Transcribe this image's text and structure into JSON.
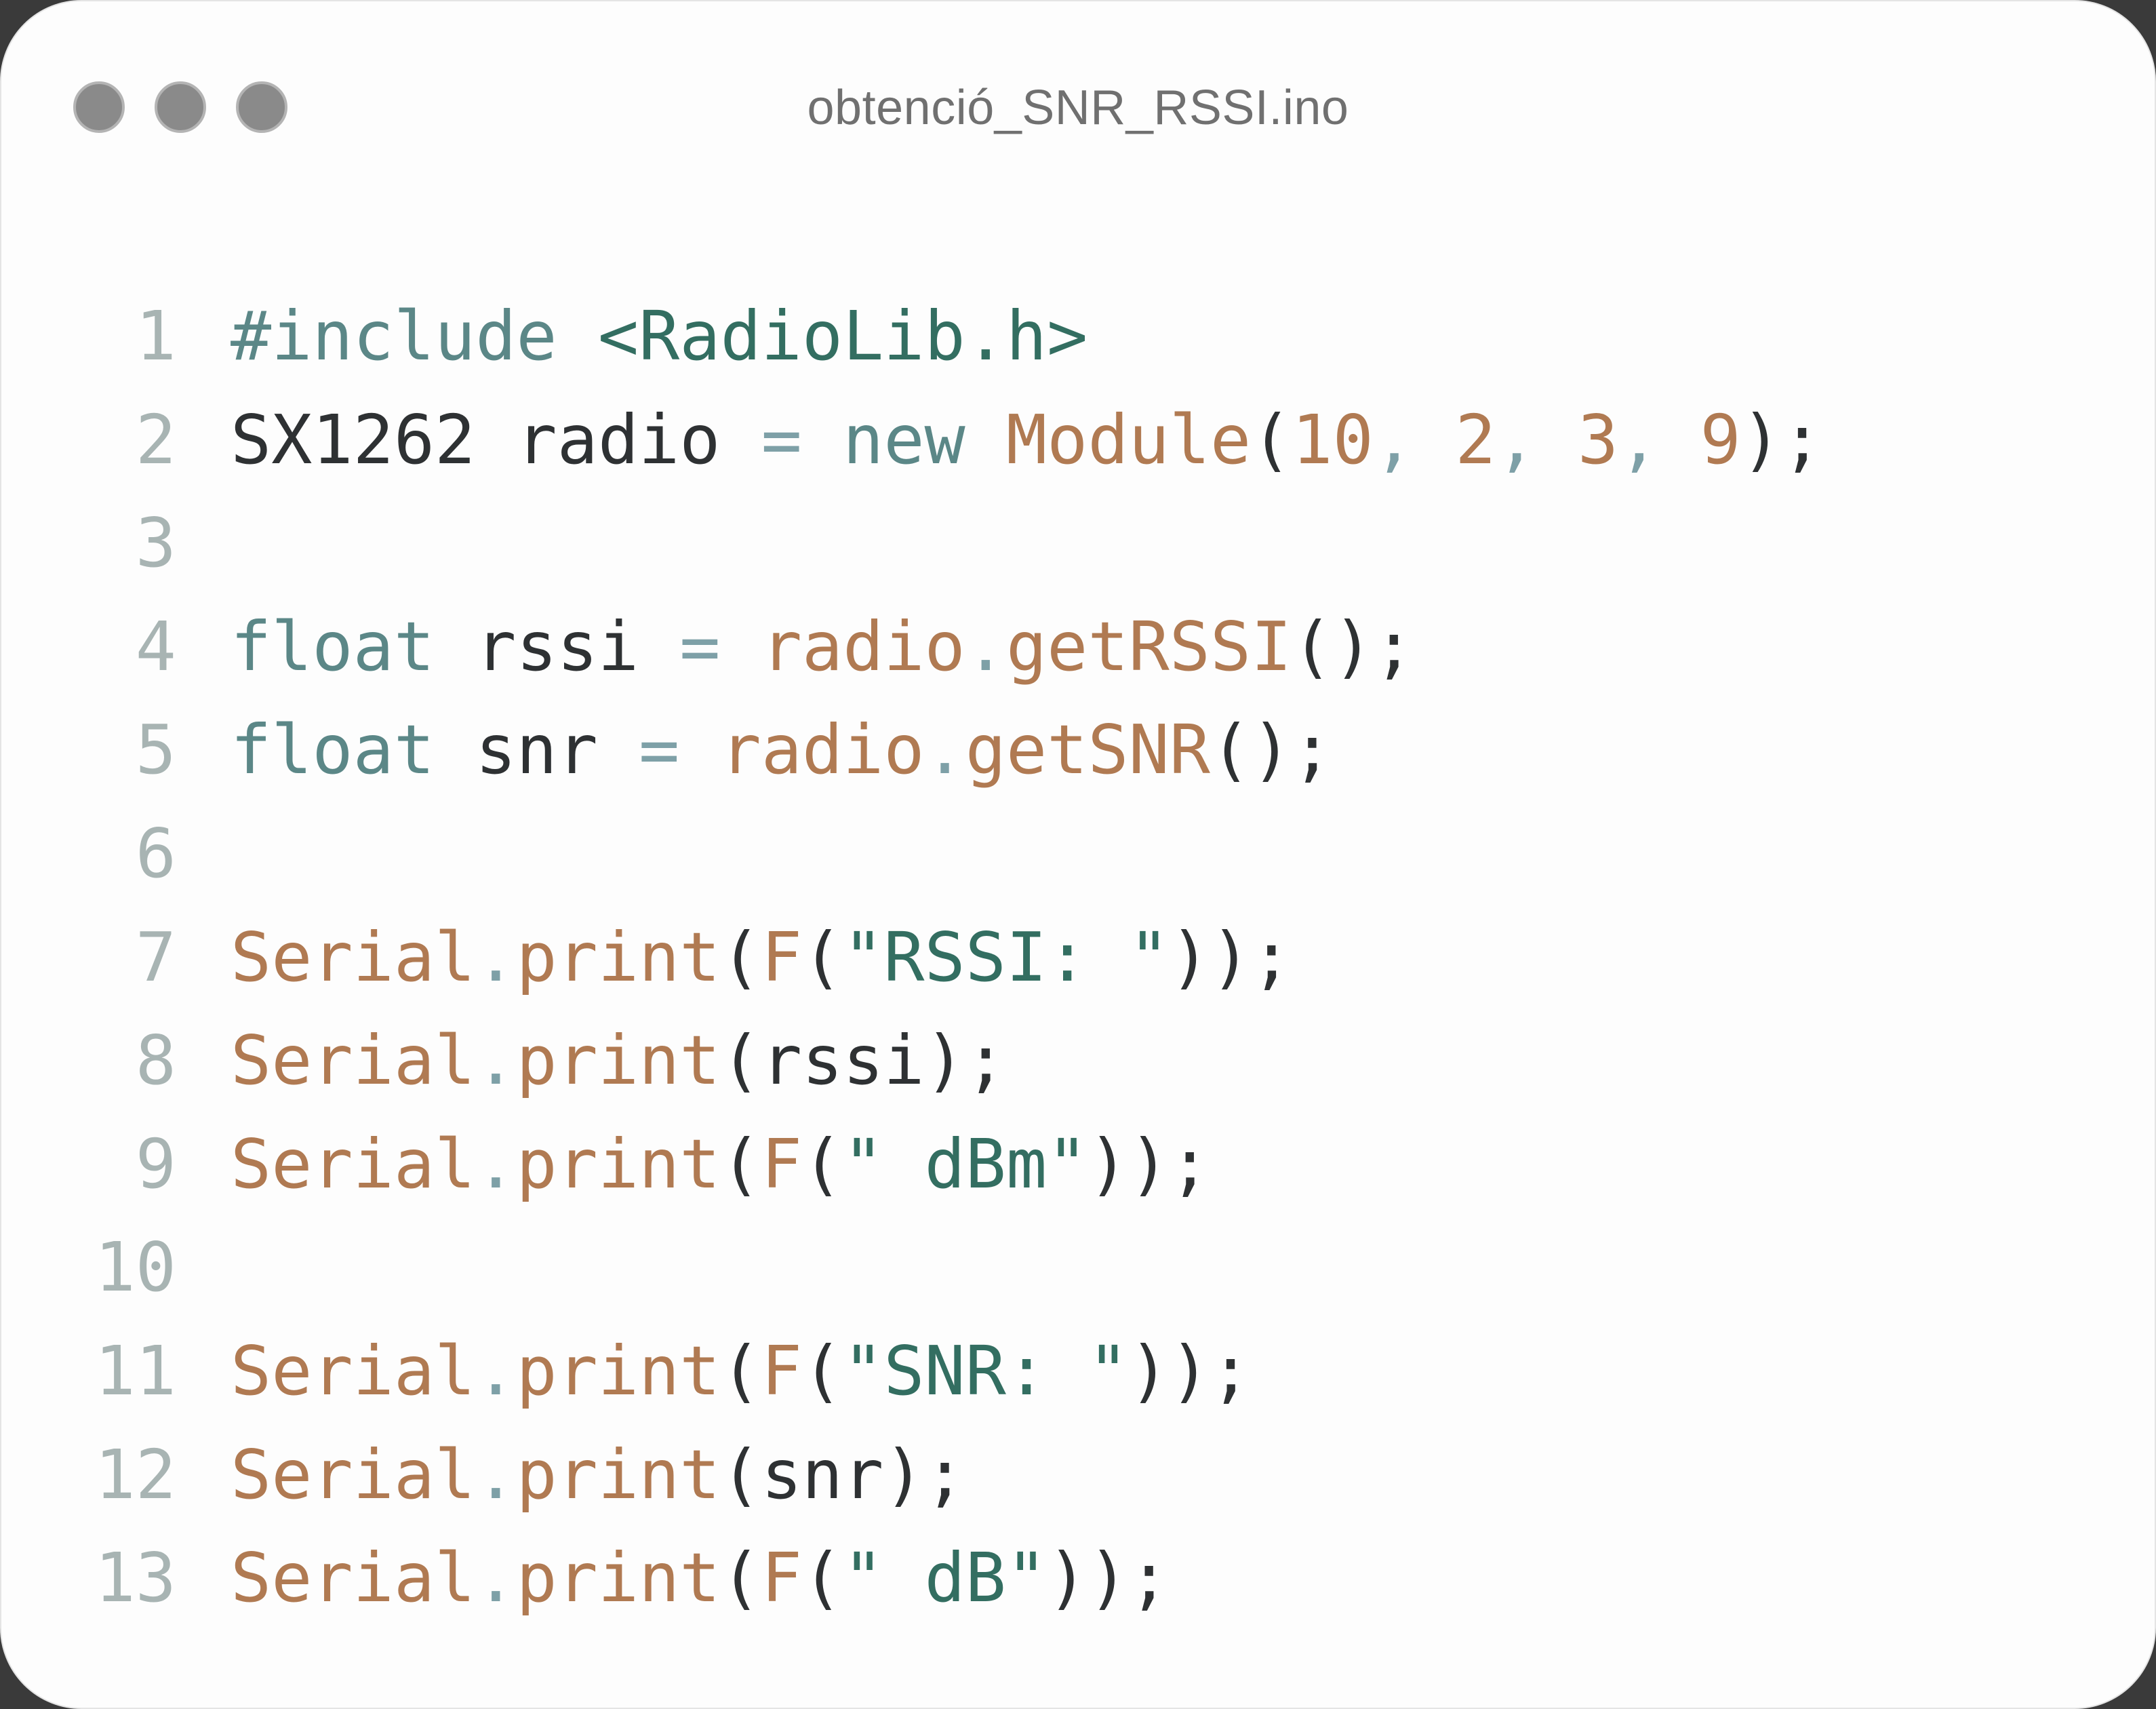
{
  "window": {
    "title": "obtenció_SNR_RSSI.ino"
  },
  "colors": {
    "keyword": "#5b8787",
    "string": "#336e61",
    "function": "#b07a52",
    "number": "#b07a52",
    "default": "#2e3133",
    "line_number": "#a8b4b3",
    "background": "#fdfdfd"
  },
  "editor": {
    "lines": [
      {
        "number": "1",
        "tokens": [
          {
            "t": "#include",
            "c": "kw"
          },
          {
            "t": " ",
            "c": "df"
          },
          {
            "t": "<RadioLib.h>",
            "c": "str"
          }
        ]
      },
      {
        "number": "2",
        "tokens": [
          {
            "t": "SX1262 radio ",
            "c": "df"
          },
          {
            "t": "=",
            "c": "pun"
          },
          {
            "t": " ",
            "c": "df"
          },
          {
            "t": "new",
            "c": "kw"
          },
          {
            "t": " ",
            "c": "df"
          },
          {
            "t": "Module",
            "c": "fn"
          },
          {
            "t": "(",
            "c": "df"
          },
          {
            "t": "10",
            "c": "num"
          },
          {
            "t": ", ",
            "c": "pun"
          },
          {
            "t": "2",
            "c": "num"
          },
          {
            "t": ", ",
            "c": "pun"
          },
          {
            "t": "3",
            "c": "num"
          },
          {
            "t": ", ",
            "c": "pun"
          },
          {
            "t": "9",
            "c": "num"
          },
          {
            "t": ");",
            "c": "df"
          }
        ]
      },
      {
        "number": "3",
        "tokens": []
      },
      {
        "number": "4",
        "tokens": [
          {
            "t": "float",
            "c": "kw"
          },
          {
            "t": " rssi ",
            "c": "df"
          },
          {
            "t": "=",
            "c": "pun"
          },
          {
            "t": " ",
            "c": "df"
          },
          {
            "t": "radio",
            "c": "fn"
          },
          {
            "t": ".",
            "c": "pun"
          },
          {
            "t": "getRSSI",
            "c": "fn"
          },
          {
            "t": "();",
            "c": "df"
          }
        ]
      },
      {
        "number": "5",
        "tokens": [
          {
            "t": "float",
            "c": "kw"
          },
          {
            "t": " snr ",
            "c": "df"
          },
          {
            "t": "=",
            "c": "pun"
          },
          {
            "t": " ",
            "c": "df"
          },
          {
            "t": "radio",
            "c": "fn"
          },
          {
            "t": ".",
            "c": "pun"
          },
          {
            "t": "getSNR",
            "c": "fn"
          },
          {
            "t": "();",
            "c": "df"
          }
        ]
      },
      {
        "number": "6",
        "tokens": []
      },
      {
        "number": "7",
        "tokens": [
          {
            "t": "Serial",
            "c": "fn"
          },
          {
            "t": ".",
            "c": "pun"
          },
          {
            "t": "print",
            "c": "fn"
          },
          {
            "t": "(",
            "c": "df"
          },
          {
            "t": "F",
            "c": "fn"
          },
          {
            "t": "(",
            "c": "df"
          },
          {
            "t": "\"RSSI: \"",
            "c": "str"
          },
          {
            "t": "));",
            "c": "df"
          }
        ]
      },
      {
        "number": "8",
        "tokens": [
          {
            "t": "Serial",
            "c": "fn"
          },
          {
            "t": ".",
            "c": "pun"
          },
          {
            "t": "print",
            "c": "fn"
          },
          {
            "t": "(rssi);",
            "c": "df"
          }
        ]
      },
      {
        "number": "9",
        "tokens": [
          {
            "t": "Serial",
            "c": "fn"
          },
          {
            "t": ".",
            "c": "pun"
          },
          {
            "t": "print",
            "c": "fn"
          },
          {
            "t": "(",
            "c": "df"
          },
          {
            "t": "F",
            "c": "fn"
          },
          {
            "t": "(",
            "c": "df"
          },
          {
            "t": "\" dBm\"",
            "c": "str"
          },
          {
            "t": "));",
            "c": "df"
          }
        ]
      },
      {
        "number": "10",
        "tokens": []
      },
      {
        "number": "11",
        "tokens": [
          {
            "t": "Serial",
            "c": "fn"
          },
          {
            "t": ".",
            "c": "pun"
          },
          {
            "t": "print",
            "c": "fn"
          },
          {
            "t": "(",
            "c": "df"
          },
          {
            "t": "F",
            "c": "fn"
          },
          {
            "t": "(",
            "c": "df"
          },
          {
            "t": "\"SNR: \"",
            "c": "str"
          },
          {
            "t": "));",
            "c": "df"
          }
        ]
      },
      {
        "number": "12",
        "tokens": [
          {
            "t": "Serial",
            "c": "fn"
          },
          {
            "t": ".",
            "c": "pun"
          },
          {
            "t": "print",
            "c": "fn"
          },
          {
            "t": "(snr);",
            "c": "df"
          }
        ]
      },
      {
        "number": "13",
        "tokens": [
          {
            "t": "Serial",
            "c": "fn"
          },
          {
            "t": ".",
            "c": "pun"
          },
          {
            "t": "print",
            "c": "fn"
          },
          {
            "t": "(",
            "c": "df"
          },
          {
            "t": "F",
            "c": "fn"
          },
          {
            "t": "(",
            "c": "df"
          },
          {
            "t": "\" dB\"",
            "c": "str"
          },
          {
            "t": "));",
            "c": "df"
          }
        ]
      }
    ]
  }
}
